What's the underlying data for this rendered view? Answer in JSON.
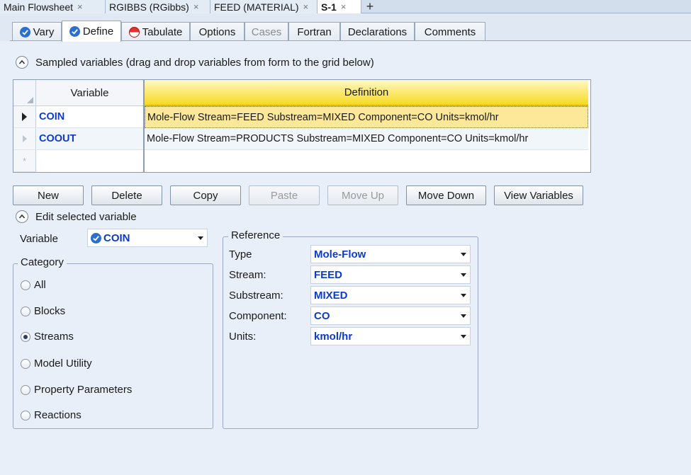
{
  "doc_tabs": [
    {
      "label": "Main Flowsheet",
      "active": false
    },
    {
      "label": "RGIBBS (RGibbs)",
      "active": false
    },
    {
      "label": "FEED (MATERIAL)",
      "active": false
    },
    {
      "label": "S-1",
      "active": true
    }
  ],
  "doc_tab_close": "×",
  "doc_tab_add": "+",
  "form_tabs": [
    {
      "label": "Vary",
      "icon": "check-icon"
    },
    {
      "label": "Define",
      "icon": "check-icon",
      "active": true
    },
    {
      "label": "Tabulate",
      "icon": "stop-icon"
    },
    {
      "label": "Options"
    },
    {
      "label": "Cases",
      "disabled": true
    },
    {
      "label": "Fortran"
    },
    {
      "label": "Declarations"
    },
    {
      "label": "Comments"
    }
  ],
  "sampled_section": {
    "title": "Sampled variables (drag and drop variables from form to the grid below)"
  },
  "grid": {
    "columns": [
      "Variable",
      "Definition"
    ],
    "rows": [
      {
        "variable": "COIN",
        "definition": "Mole-Flow Stream=FEED Substream=MIXED Component=CO Units=kmol/hr",
        "selected": true
      },
      {
        "variable": "COOUT",
        "definition": "Mole-Flow Stream=PRODUCTS Substream=MIXED Component=CO Units=kmol/hr",
        "selected": false
      }
    ],
    "new_row_marker": "*"
  },
  "buttons": [
    {
      "label": "New",
      "enabled": true
    },
    {
      "label": "Delete",
      "enabled": true
    },
    {
      "label": "Copy",
      "enabled": true
    },
    {
      "label": "Paste",
      "enabled": false
    },
    {
      "label": "Move Up",
      "enabled": false
    },
    {
      "label": "Move Down",
      "enabled": true
    },
    {
      "label": "View Variables",
      "enabled": true
    }
  ],
  "edit_section": {
    "title": "Edit selected variable",
    "variable_label": "Variable",
    "variable_value": "COIN"
  },
  "category": {
    "title": "Category",
    "options": [
      {
        "label": "All",
        "selected": false
      },
      {
        "label": "Blocks",
        "selected": false
      },
      {
        "label": "Streams",
        "selected": true
      },
      {
        "label": "Model Utility",
        "selected": false
      },
      {
        "label": "Property Parameters",
        "selected": false
      },
      {
        "label": "Reactions",
        "selected": false
      }
    ]
  },
  "reference": {
    "title": "Reference",
    "fields": [
      {
        "label": "Type",
        "value": "Mole-Flow"
      },
      {
        "label": "Stream:",
        "value": "FEED"
      },
      {
        "label": "Substream:",
        "value": "MIXED"
      },
      {
        "label": "Component:",
        "value": "CO"
      },
      {
        "label": "Units:",
        "value": "kmol/hr"
      }
    ]
  },
  "colors": {
    "accent_blue": "#0a3bd1",
    "header_yellow": "#f7d920",
    "selected_row": "#fde89a"
  }
}
